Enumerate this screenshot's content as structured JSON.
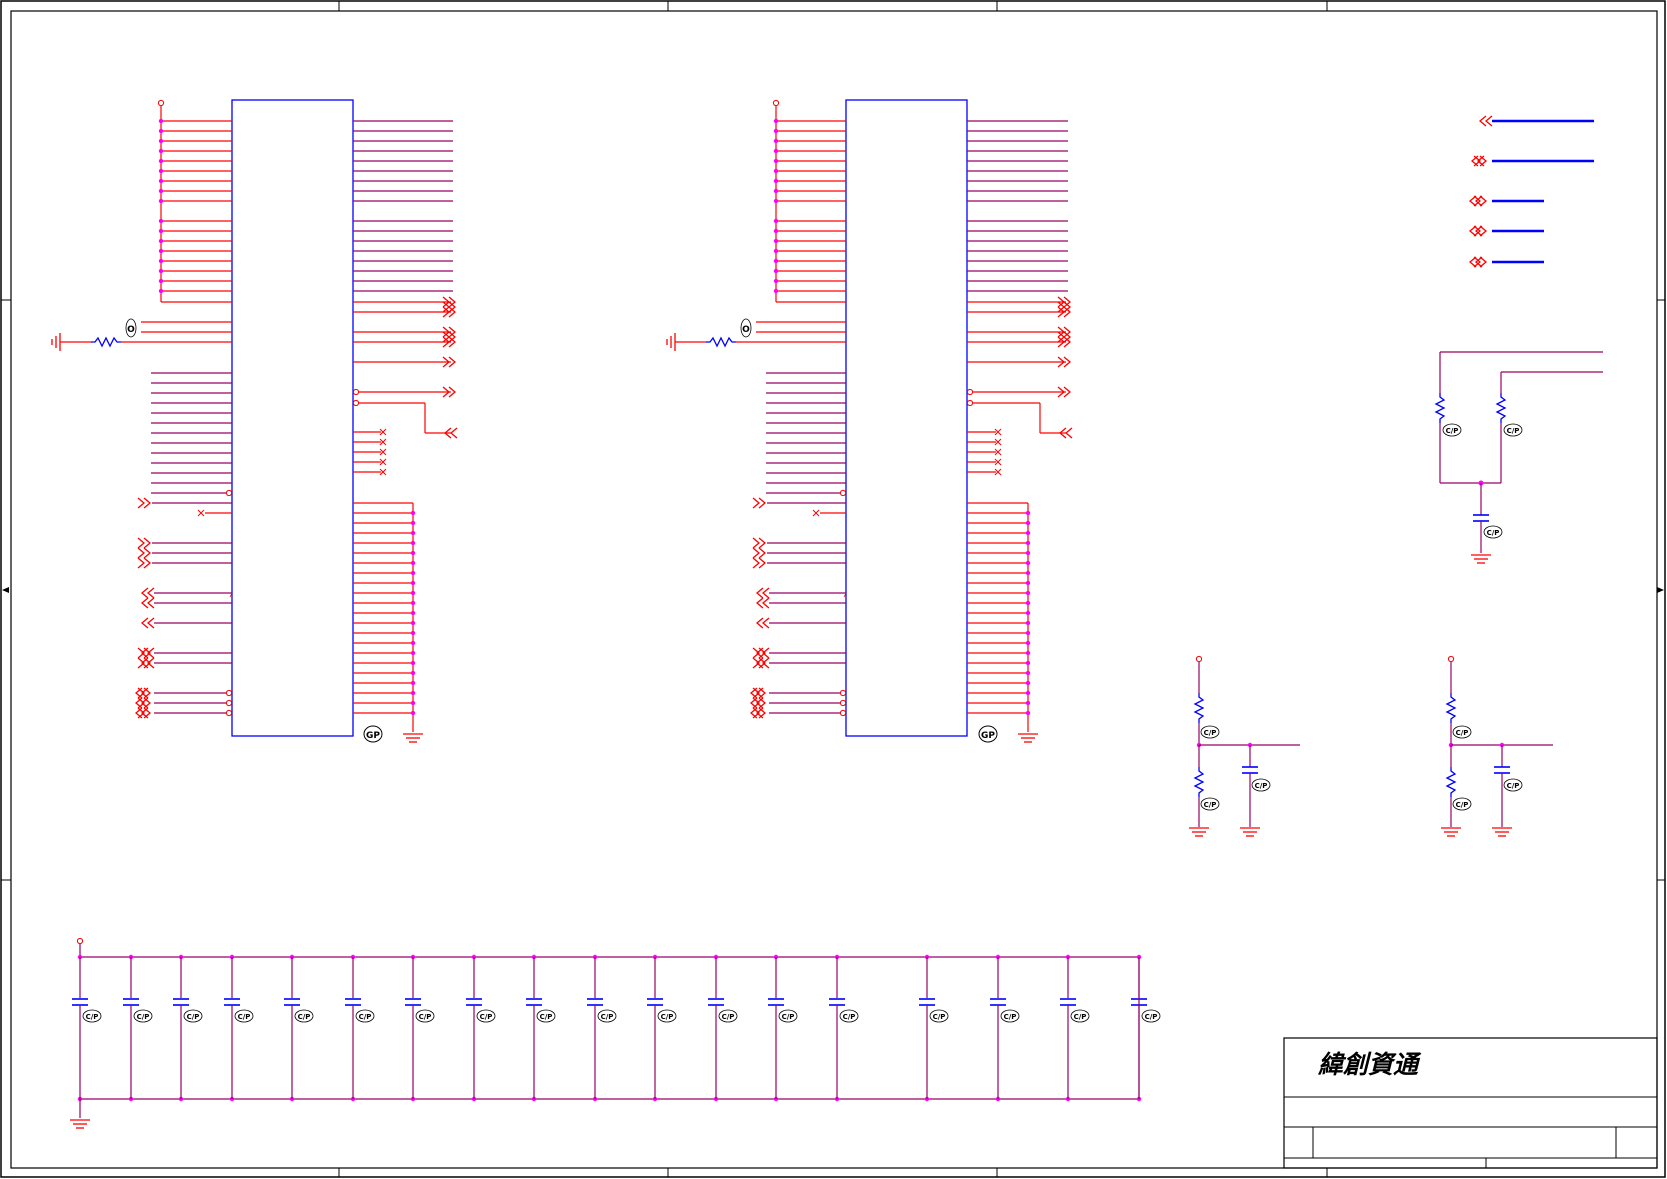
{
  "title_block": {
    "company": "緯創資通"
  },
  "badges": {
    "ground_plane_label": "GP",
    "cap_mark": "C/P",
    "res_mark": "C/P",
    "mount_mark": "O"
  },
  "colors": {
    "wire": "#ff0000",
    "component": "#0000ff",
    "bus": "#990066",
    "junction": "#ff00ff",
    "frame": "#000000"
  }
}
